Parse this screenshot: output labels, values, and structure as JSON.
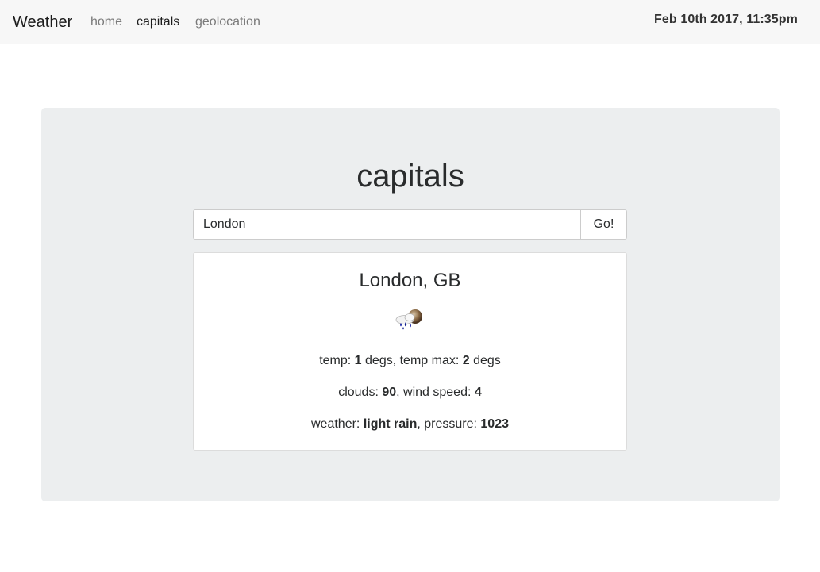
{
  "navbar": {
    "brand": "Weather",
    "links": [
      {
        "label": "home",
        "active": false
      },
      {
        "label": "capitals",
        "active": true
      },
      {
        "label": "geolocation",
        "active": false
      }
    ],
    "datetime": "Feb 10th 2017, 11:35pm"
  },
  "main": {
    "title": "capitals",
    "search": {
      "value": "London",
      "button_label": "Go!"
    },
    "result": {
      "location": "London, GB",
      "icon": "light-rain-icon",
      "temp_label": "temp: ",
      "temp": "1",
      "temp_unit_sep": " degs, temp max: ",
      "temp_max": "2",
      "temp_max_unit": " degs",
      "clouds_label": "clouds: ",
      "clouds": "90",
      "wind_label": ", wind speed: ",
      "wind_speed": "4",
      "weather_label": "weather: ",
      "weather": "light rain",
      "pressure_label": ", pressure: ",
      "pressure": "1023"
    }
  }
}
